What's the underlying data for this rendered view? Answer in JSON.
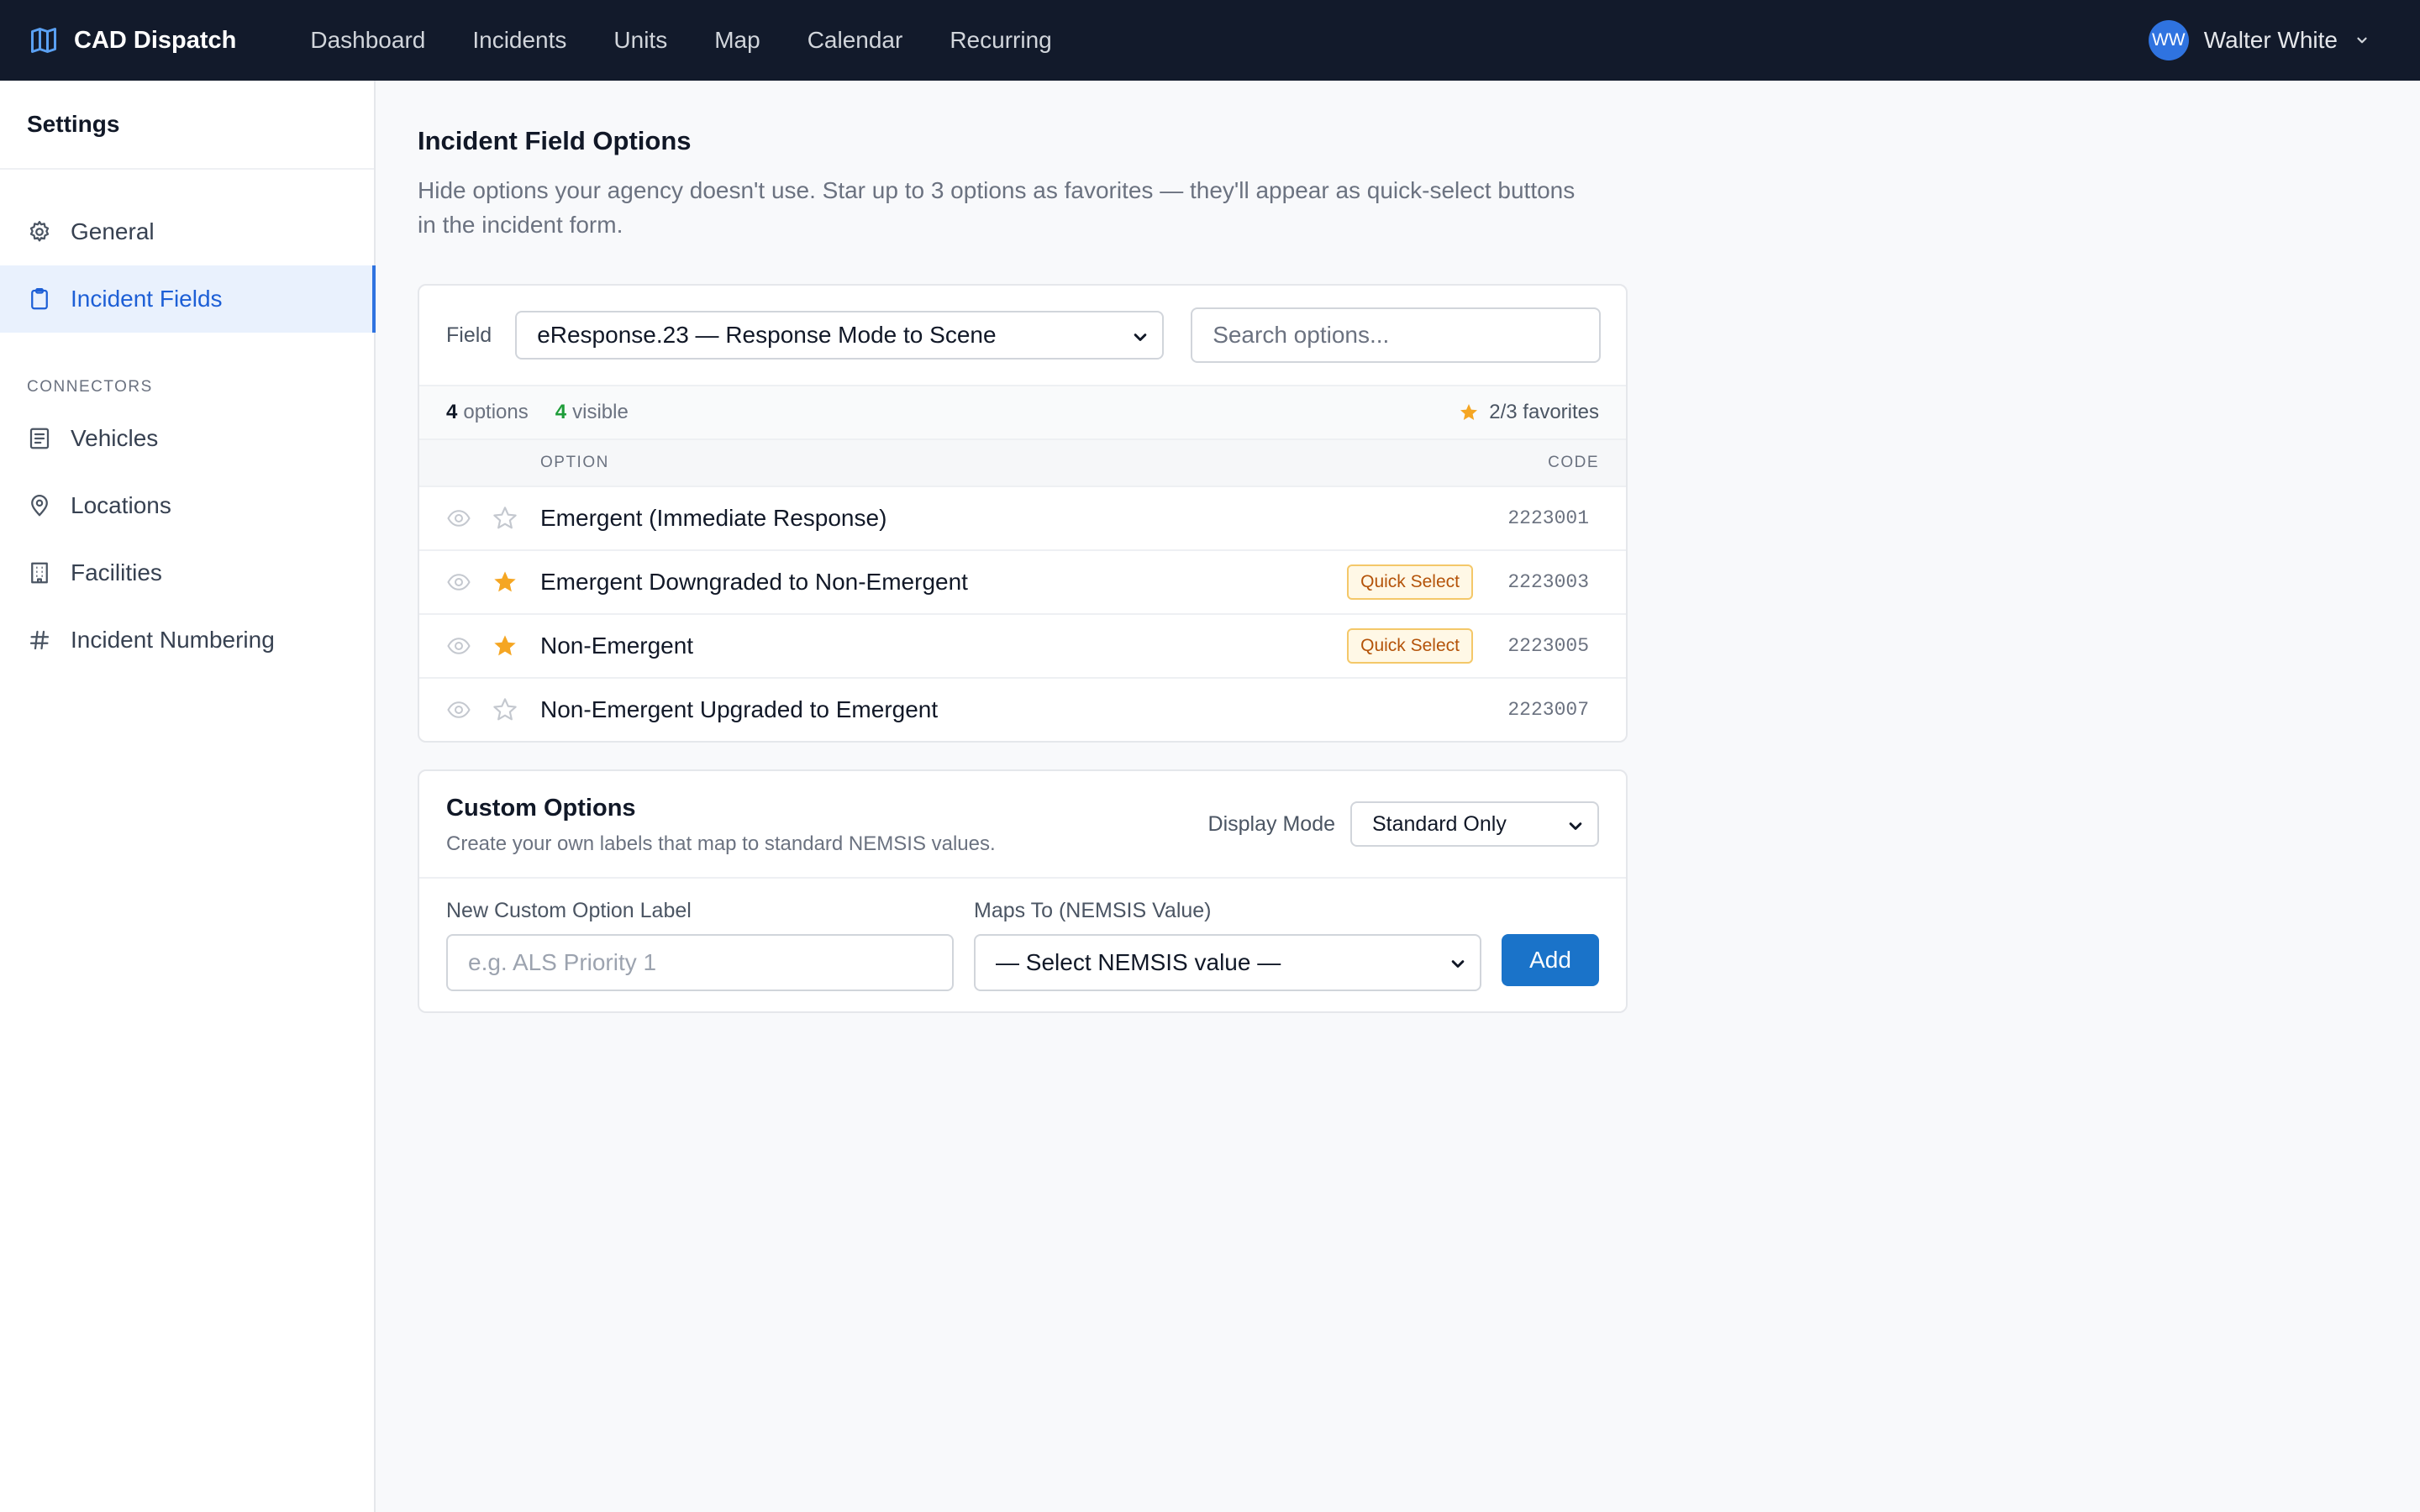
{
  "app": {
    "name": "CAD Dispatch",
    "nav": [
      "Dashboard",
      "Incidents",
      "Units",
      "Map",
      "Calendar",
      "Recurring"
    ],
    "user": {
      "initials": "WW",
      "name": "Walter White"
    }
  },
  "sidebar": {
    "title": "Settings",
    "items": [
      {
        "label": "General",
        "icon": "gear-icon",
        "active": false
      },
      {
        "label": "Incident Fields",
        "icon": "clipboard-icon",
        "active": true
      }
    ],
    "section_label": "CONNECTORS",
    "connectors": [
      {
        "label": "Vehicles",
        "icon": "list-icon"
      },
      {
        "label": "Locations",
        "icon": "map-pin-icon"
      },
      {
        "label": "Facilities",
        "icon": "building-icon"
      },
      {
        "label": "Incident Numbering",
        "icon": "hash-icon"
      }
    ]
  },
  "page": {
    "title": "Incident Field Options",
    "description": "Hide options your agency doesn't use. Star up to 3 options as favorites — they'll appear as quick-select buttons in the incident form."
  },
  "options_card": {
    "field_label": "Field",
    "field_value": "eResponse.23 — Response Mode to Scene",
    "search_placeholder": "Search options...",
    "stats": {
      "options_count": "4",
      "options_label": "options",
      "visible_count": "4",
      "visible_label": "visible",
      "favorites": "2/3 favorites"
    },
    "columns": {
      "option": "OPTION",
      "code": "CODE"
    },
    "rows": [
      {
        "label": "Emergent (Immediate Response)",
        "code": "2223001",
        "favorite": false,
        "badge": ""
      },
      {
        "label": "Emergent Downgraded to Non-Emergent",
        "code": "2223003",
        "favorite": true,
        "badge": "Quick Select"
      },
      {
        "label": "Non-Emergent",
        "code": "2223005",
        "favorite": true,
        "badge": "Quick Select"
      },
      {
        "label": "Non-Emergent Upgraded to Emergent",
        "code": "2223007",
        "favorite": false,
        "badge": ""
      }
    ]
  },
  "custom_card": {
    "title": "Custom Options",
    "subtitle": "Create your own labels that map to standard NEMSIS values.",
    "display_mode_label": "Display Mode",
    "display_mode_value": "Standard Only",
    "label_field_label": "New Custom Option Label",
    "label_placeholder": "e.g. ALS Priority 1",
    "maps_to_label": "Maps To (NEMSIS Value)",
    "maps_to_value": "— Select NEMSIS value —",
    "add_label": "Add"
  },
  "colors": {
    "topbar": "#121a2b",
    "accent": "#1a73c9",
    "favorite_star": "#f5a623",
    "visible_green": "#1f9d3a"
  }
}
